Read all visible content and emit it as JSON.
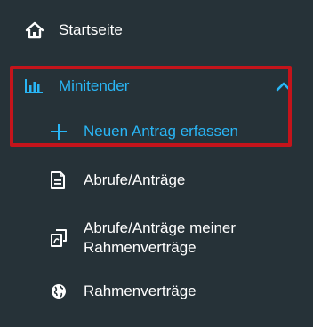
{
  "colors": {
    "background": "#263238",
    "text": "#ffffff",
    "active": "#29b6f6",
    "highlight_border": "#c4141b"
  },
  "nav": {
    "home": {
      "label": "Startseite",
      "icon": "home-icon"
    },
    "section": {
      "label": "Minitender",
      "icon": "bar-chart-icon",
      "expanded": true,
      "toggle_icon": "chevron-up-icon"
    },
    "sub_items": [
      {
        "label": "Neuen Antrag erfassen",
        "icon": "plus-icon",
        "active": true
      }
    ],
    "items": [
      {
        "label": "Abrufe/Anträge",
        "icon": "document-icon"
      },
      {
        "label_line1": "Abrufe/Anträge meiner",
        "label_line2": "Rahmenverträge",
        "icon": "documents-stack-icon"
      },
      {
        "label": "Rahmenverträge",
        "icon": "globe-icon"
      }
    ]
  }
}
